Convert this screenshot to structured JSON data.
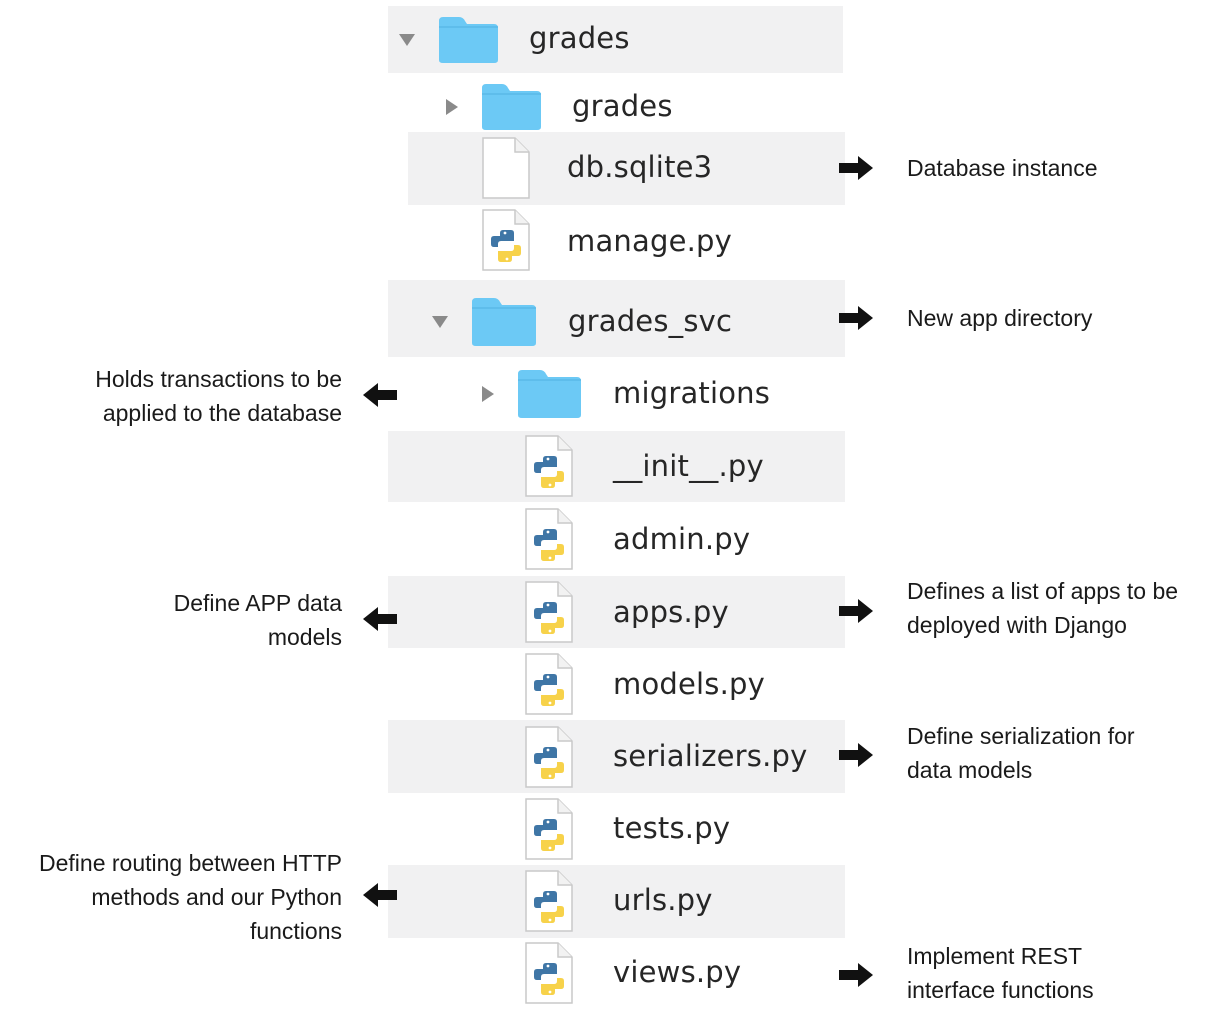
{
  "tree": {
    "grades_root": "grades",
    "grades_pkg": "grades",
    "db_file": "db.sqlite3",
    "manage_file": "manage.py",
    "svc_dir": "grades_svc",
    "migrations_dir": "migrations",
    "init_file": "__init__.py",
    "admin_file": "admin.py",
    "apps_file": "apps.py",
    "models_file": "models.py",
    "serializers_file": "serializers.py",
    "tests_file": "tests.py",
    "urls_file": "urls.py",
    "views_file": "views.py"
  },
  "annotations": {
    "db": [
      "Database instance"
    ],
    "svc": [
      "New app directory"
    ],
    "migrations": [
      "Holds transactions to be",
      "applied to the database"
    ],
    "apps_left": [
      "Define APP data",
      "models"
    ],
    "apps_right": [
      "Defines a list of apps to be",
      "deployed with Django"
    ],
    "serializers": [
      "Define serialization for",
      "data models"
    ],
    "urls": [
      "Define routing between HTTP",
      "methods and our Python",
      "functions"
    ],
    "views": [
      "Implement REST",
      "interface functions"
    ]
  },
  "colors": {
    "folder": "#6cc9f5",
    "row_shade": "#f1f1f2",
    "python_blue": "#3f76a6",
    "python_yellow": "#f7d24a"
  },
  "icons": {
    "folder": "folder-icon",
    "python": "python-file-icon",
    "blank": "blank-file-icon",
    "arrow": "arrow-icon"
  }
}
